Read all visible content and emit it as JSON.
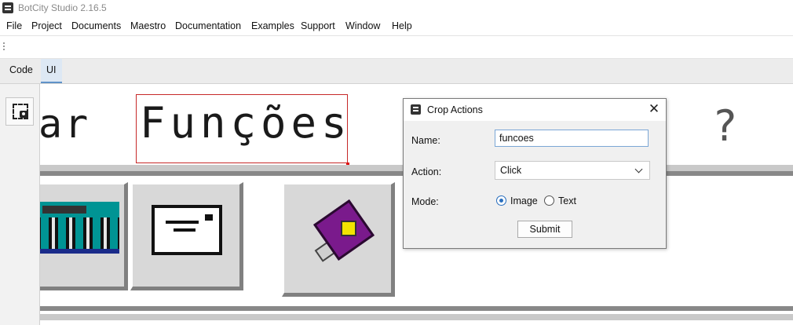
{
  "window": {
    "title": "BotCity Studio 2.16.5"
  },
  "menu": [
    "File",
    "Project",
    "Documents",
    "Maestro",
    "Documentation",
    "Examples",
    "Support",
    "Window",
    "Help"
  ],
  "tabs": [
    {
      "label": "Code",
      "active": false
    },
    {
      "label": "UI",
      "active": true
    }
  ],
  "sidebar": {
    "crop_tool_icon": "crop-screenshot-icon"
  },
  "canvas": {
    "left_text": "ar",
    "selected_text": "Funções",
    "right_text": "?",
    "selection_color": "#c62828",
    "tiles": [
      {
        "icon": "calculator-icon"
      },
      {
        "icon": "envelope-icon"
      },
      {
        "icon": "help-book-icon"
      }
    ]
  },
  "dialog": {
    "title": "Crop Actions",
    "name_label": "Name:",
    "name_value": "funcoes",
    "action_label": "Action:",
    "action_value": "Click",
    "mode_label": "Mode:",
    "mode_options": [
      {
        "label": "Image",
        "selected": true
      },
      {
        "label": "Text",
        "selected": false
      }
    ],
    "submit_label": "Submit",
    "accent_color": "#2a6fbe"
  }
}
